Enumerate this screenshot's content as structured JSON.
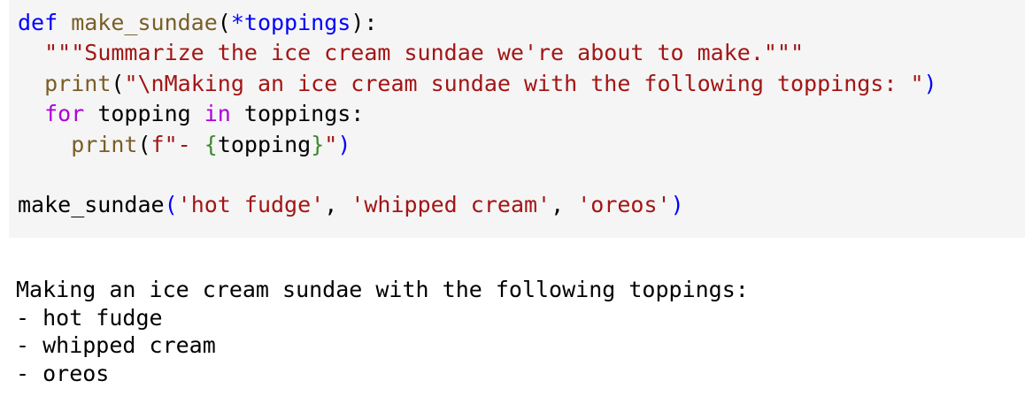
{
  "colors": {
    "cell_background": "#f5f5f5",
    "plain": "#000000",
    "keyword": "#0000ff",
    "function_name": "#795e26",
    "string": "#a31515",
    "control_keyword": "#af00db",
    "builtin": "#795e26",
    "interpolation_brace": "#3c8a2e",
    "operator": "#000000"
  },
  "code_cell": {
    "lines": [
      [
        {
          "text": "def",
          "kind": "keyword"
        },
        {
          "text": " make_sundae",
          "kind": "function_name"
        },
        {
          "text": "(",
          "kind": "punct"
        },
        {
          "text": "*toppings",
          "kind": "keyword"
        },
        {
          "text": "):",
          "kind": "punct"
        }
      ],
      [
        {
          "text": "  ",
          "kind": "plain"
        },
        {
          "text": "\"\"\"Summarize the ice cream sundae we're about to make.\"\"\"",
          "kind": "string"
        }
      ],
      [
        {
          "text": "  ",
          "kind": "plain"
        },
        {
          "text": "print",
          "kind": "builtin"
        },
        {
          "text": "(",
          "kind": "punct"
        },
        {
          "text": "\"\\nMaking an ice cream sundae with the following toppings: \"",
          "kind": "string"
        },
        {
          "text": ")",
          "kind": "keyword"
        }
      ],
      [
        {
          "text": "  ",
          "kind": "plain"
        },
        {
          "text": "for",
          "kind": "control_keyword"
        },
        {
          "text": " topping ",
          "kind": "plain"
        },
        {
          "text": "in",
          "kind": "control_keyword"
        },
        {
          "text": " toppings:",
          "kind": "plain"
        }
      ],
      [
        {
          "text": "    ",
          "kind": "plain"
        },
        {
          "text": "print",
          "kind": "builtin"
        },
        {
          "text": "(",
          "kind": "punct"
        },
        {
          "text": "f\"- ",
          "kind": "string"
        },
        {
          "text": "{",
          "kind": "interpolation_brace"
        },
        {
          "text": "topping",
          "kind": "plain"
        },
        {
          "text": "}",
          "kind": "interpolation_brace"
        },
        {
          "text": "\"",
          "kind": "string"
        },
        {
          "text": ")",
          "kind": "keyword"
        }
      ],
      [
        {
          "text": "",
          "kind": "plain"
        }
      ],
      [
        {
          "text": "make_sundae",
          "kind": "plain"
        },
        {
          "text": "(",
          "kind": "keyword"
        },
        {
          "text": "'hot fudge'",
          "kind": "string"
        },
        {
          "text": ", ",
          "kind": "plain"
        },
        {
          "text": "'whipped cream'",
          "kind": "string"
        },
        {
          "text": ", ",
          "kind": "plain"
        },
        {
          "text": "'oreos'",
          "kind": "string"
        },
        {
          "text": ")",
          "kind": "keyword"
        }
      ]
    ]
  },
  "output_cell": {
    "lines": [
      "Making an ice cream sundae with the following toppings:",
      "- hot fudge",
      "- whipped cream",
      "- oreos"
    ]
  }
}
